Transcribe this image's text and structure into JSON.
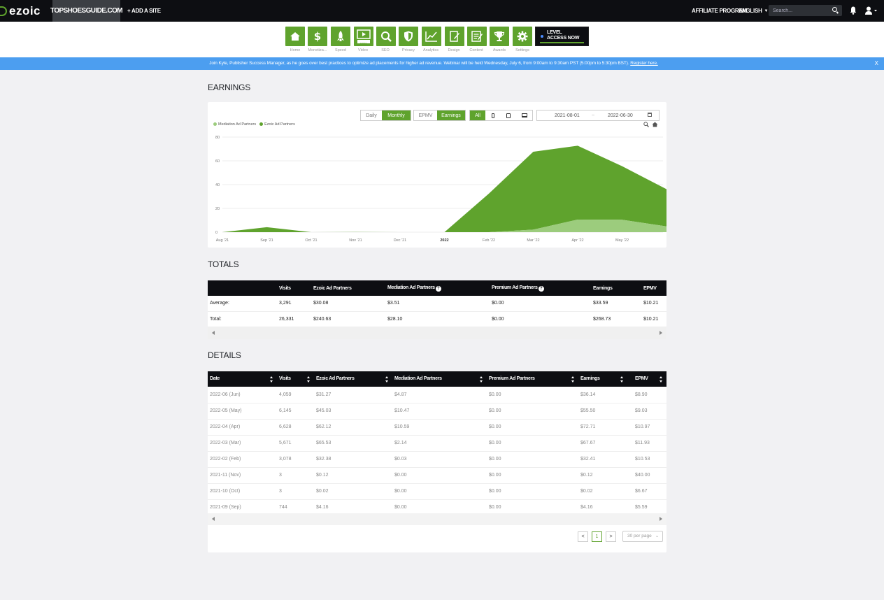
{
  "topbar": {
    "logo": "ezoic",
    "site": "TOPSHOESGUIDE.COM",
    "add_site": "+ ADD A SITE",
    "affiliate": "AFFILIATE PROGRAM",
    "language": "ENGLISH",
    "search_placeholder": "Search..."
  },
  "iconbar": {
    "items": [
      {
        "label": "Home",
        "icon": "home-icon"
      },
      {
        "label": "Monetiza...",
        "icon": "dollar-icon"
      },
      {
        "label": "Speed",
        "icon": "rocket-icon"
      },
      {
        "label": "Video",
        "icon": "video-icon",
        "badge": "BETA"
      },
      {
        "label": "SEO",
        "icon": "magnifier-icon"
      },
      {
        "label": "Privacy",
        "icon": "shield-icon"
      },
      {
        "label": "Analytics",
        "icon": "chart-line-icon"
      },
      {
        "label": "Design",
        "icon": "design-icon"
      },
      {
        "label": "Content",
        "icon": "content-icon"
      },
      {
        "label": "Awards",
        "icon": "trophy-icon"
      },
      {
        "label": "Settings",
        "icon": "gear-icon"
      }
    ],
    "level_line1": "LEVEL",
    "level_line2": "ACCESS NOW"
  },
  "banner": {
    "message": "Join Kyle, Publisher Success Manager, as he goes over best practices to optimize ad placements for higher ad revenue. Webinar will be held Wednesday, July 6, from 9:00am to 9:30am PST (5:00pm to 5:30pm BST).",
    "link": "Register here.",
    "close": "X"
  },
  "earnings": {
    "title": "EARNINGS",
    "toggle_daily": "Daily",
    "toggle_monthly": "Monthly",
    "metric_epmv": "EPMV",
    "metric_earnings": "Earnings",
    "device_all": "All",
    "date_from": "2021-08-01",
    "date_sep": "~",
    "date_to": "2022-06-30"
  },
  "chart_data": {
    "type": "area",
    "stacked": true,
    "categories": [
      "Aug '21",
      "Sep '21",
      "Oct '21",
      "Nov '21",
      "Dec '21",
      "2022",
      "Feb '22",
      "Mar '22",
      "Apr '22",
      "May '22",
      "Jun '22"
    ],
    "x_tick_labels": [
      "Aug '21",
      "Sep '21",
      "Oct '21",
      "Nov '21",
      "Dec '21",
      "2022",
      "Feb '22",
      "Mar '22",
      "Apr '22",
      "May '22"
    ],
    "series": [
      {
        "name": "Mediation Ad Partners",
        "color": "#9ccc7d",
        "values": [
          0,
          0,
          0,
          0,
          0,
          0,
          0.03,
          2.14,
          10.59,
          10.47,
          4.87
        ]
      },
      {
        "name": "Ezoic Ad Partners",
        "color": "#5fa32d",
        "values": [
          0,
          4.16,
          0.02,
          0.12,
          0,
          0,
          32.38,
          65.53,
          62.12,
          45.03,
          31.27
        ]
      }
    ],
    "ylim": [
      0,
      80
    ],
    "yticks": [
      0,
      20,
      40,
      60,
      80
    ],
    "grid": true,
    "legend": "top-left"
  },
  "totals": {
    "title": "TOTALS",
    "headers": [
      "",
      "Visits",
      "Ezoic Ad Partners",
      "Mediation Ad Partners",
      "Premium Ad Partners",
      "Earnings",
      "EPMV"
    ],
    "rows": [
      [
        "Average:",
        "3,291",
        "$30.08",
        "$3.51",
        "$0.00",
        "$33.59",
        "$10.21"
      ],
      [
        "Total:",
        "26,331",
        "$240.63",
        "$28.10",
        "$0.00",
        "$268.73",
        "$10.21"
      ]
    ]
  },
  "details": {
    "title": "DETAILS",
    "headers": [
      "Date",
      "Visits",
      "Ezoic Ad Partners",
      "Mediation Ad Partners",
      "Premium Ad Partners",
      "Earnings",
      "EPMV"
    ],
    "rows": [
      [
        "2022-06 (Jun)",
        "4,059",
        "$31.27",
        "$4.87",
        "$0.00",
        "$36.14",
        "$8.90"
      ],
      [
        "2022-05 (May)",
        "6,145",
        "$45.03",
        "$10.47",
        "$0.00",
        "$55.50",
        "$9.03"
      ],
      [
        "2022-04 (Apr)",
        "6,628",
        "$62.12",
        "$10.59",
        "$0.00",
        "$72.71",
        "$10.97"
      ],
      [
        "2022-03 (Mar)",
        "5,671",
        "$65.53",
        "$2.14",
        "$0.00",
        "$67.67",
        "$11.93"
      ],
      [
        "2022-02 (Feb)",
        "3,078",
        "$32.38",
        "$0.03",
        "$0.00",
        "$32.41",
        "$10.53"
      ],
      [
        "2021-11 (Nov)",
        "3",
        "$0.12",
        "$0.00",
        "$0.00",
        "$0.12",
        "$40.00"
      ],
      [
        "2021-10 (Oct)",
        "3",
        "$0.02",
        "$0.00",
        "$0.00",
        "$0.02",
        "$6.67"
      ],
      [
        "2021-09 (Sep)",
        "744",
        "$4.16",
        "$0.00",
        "$0.00",
        "$4.16",
        "$5.59"
      ]
    ],
    "page_prev": "<",
    "page_current": "1",
    "page_next": ">",
    "per_page": "30 per page"
  }
}
